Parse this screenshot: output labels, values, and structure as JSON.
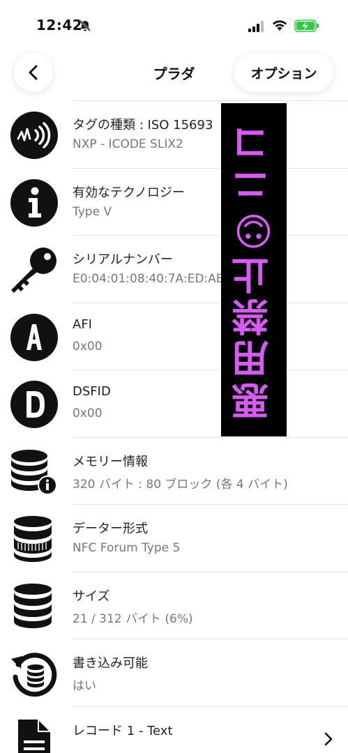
{
  "status_bar": {
    "time": "12:42",
    "icons": [
      "bell-slash-icon",
      "signal-icon",
      "wifi-icon",
      "battery-charging-icon"
    ],
    "battery_color": "#2ecc40"
  },
  "nav": {
    "back_icon": "chevron-left-icon",
    "title": "プラダ",
    "options_label": "オプション"
  },
  "rows": [
    {
      "icon": "nfc-tag-icon",
      "title": "タグの種類 : ISO 15693",
      "value": "NXP - ICODE SLIX2"
    },
    {
      "icon": "info-icon",
      "title": "有効なテクノロジー",
      "value": "Type V"
    },
    {
      "icon": "key-icon",
      "title": "シリアルナンバー",
      "value": "E0:04:01:08:40:7A:ED:AB"
    },
    {
      "icon": "letter-a-icon",
      "title": "AFI",
      "value": "0x00"
    },
    {
      "icon": "letter-d-icon",
      "title": "DSFID",
      "value": "0x00"
    },
    {
      "icon": "database-info-icon",
      "title": "メモリー情報",
      "value": "320 バイト : 80 ブロック (各 4 バイト)"
    },
    {
      "icon": "database-format-icon",
      "title": "データー形式",
      "value": "NFC Forum Type 5"
    },
    {
      "icon": "database-icon",
      "title": "サイズ",
      "value": "21 / 312 バイト (6%)"
    },
    {
      "icon": "writable-refresh-icon",
      "title": "書き込み可能",
      "value": "はい"
    },
    {
      "icon": "document-icon",
      "title": "レコード 1 - Text",
      "value": ""
    }
  ],
  "overlay": {
    "stamp_text": "悪用禁止☺ニコ",
    "stamp_color": "#d65bf0",
    "stamp_bg": "#000000"
  }
}
